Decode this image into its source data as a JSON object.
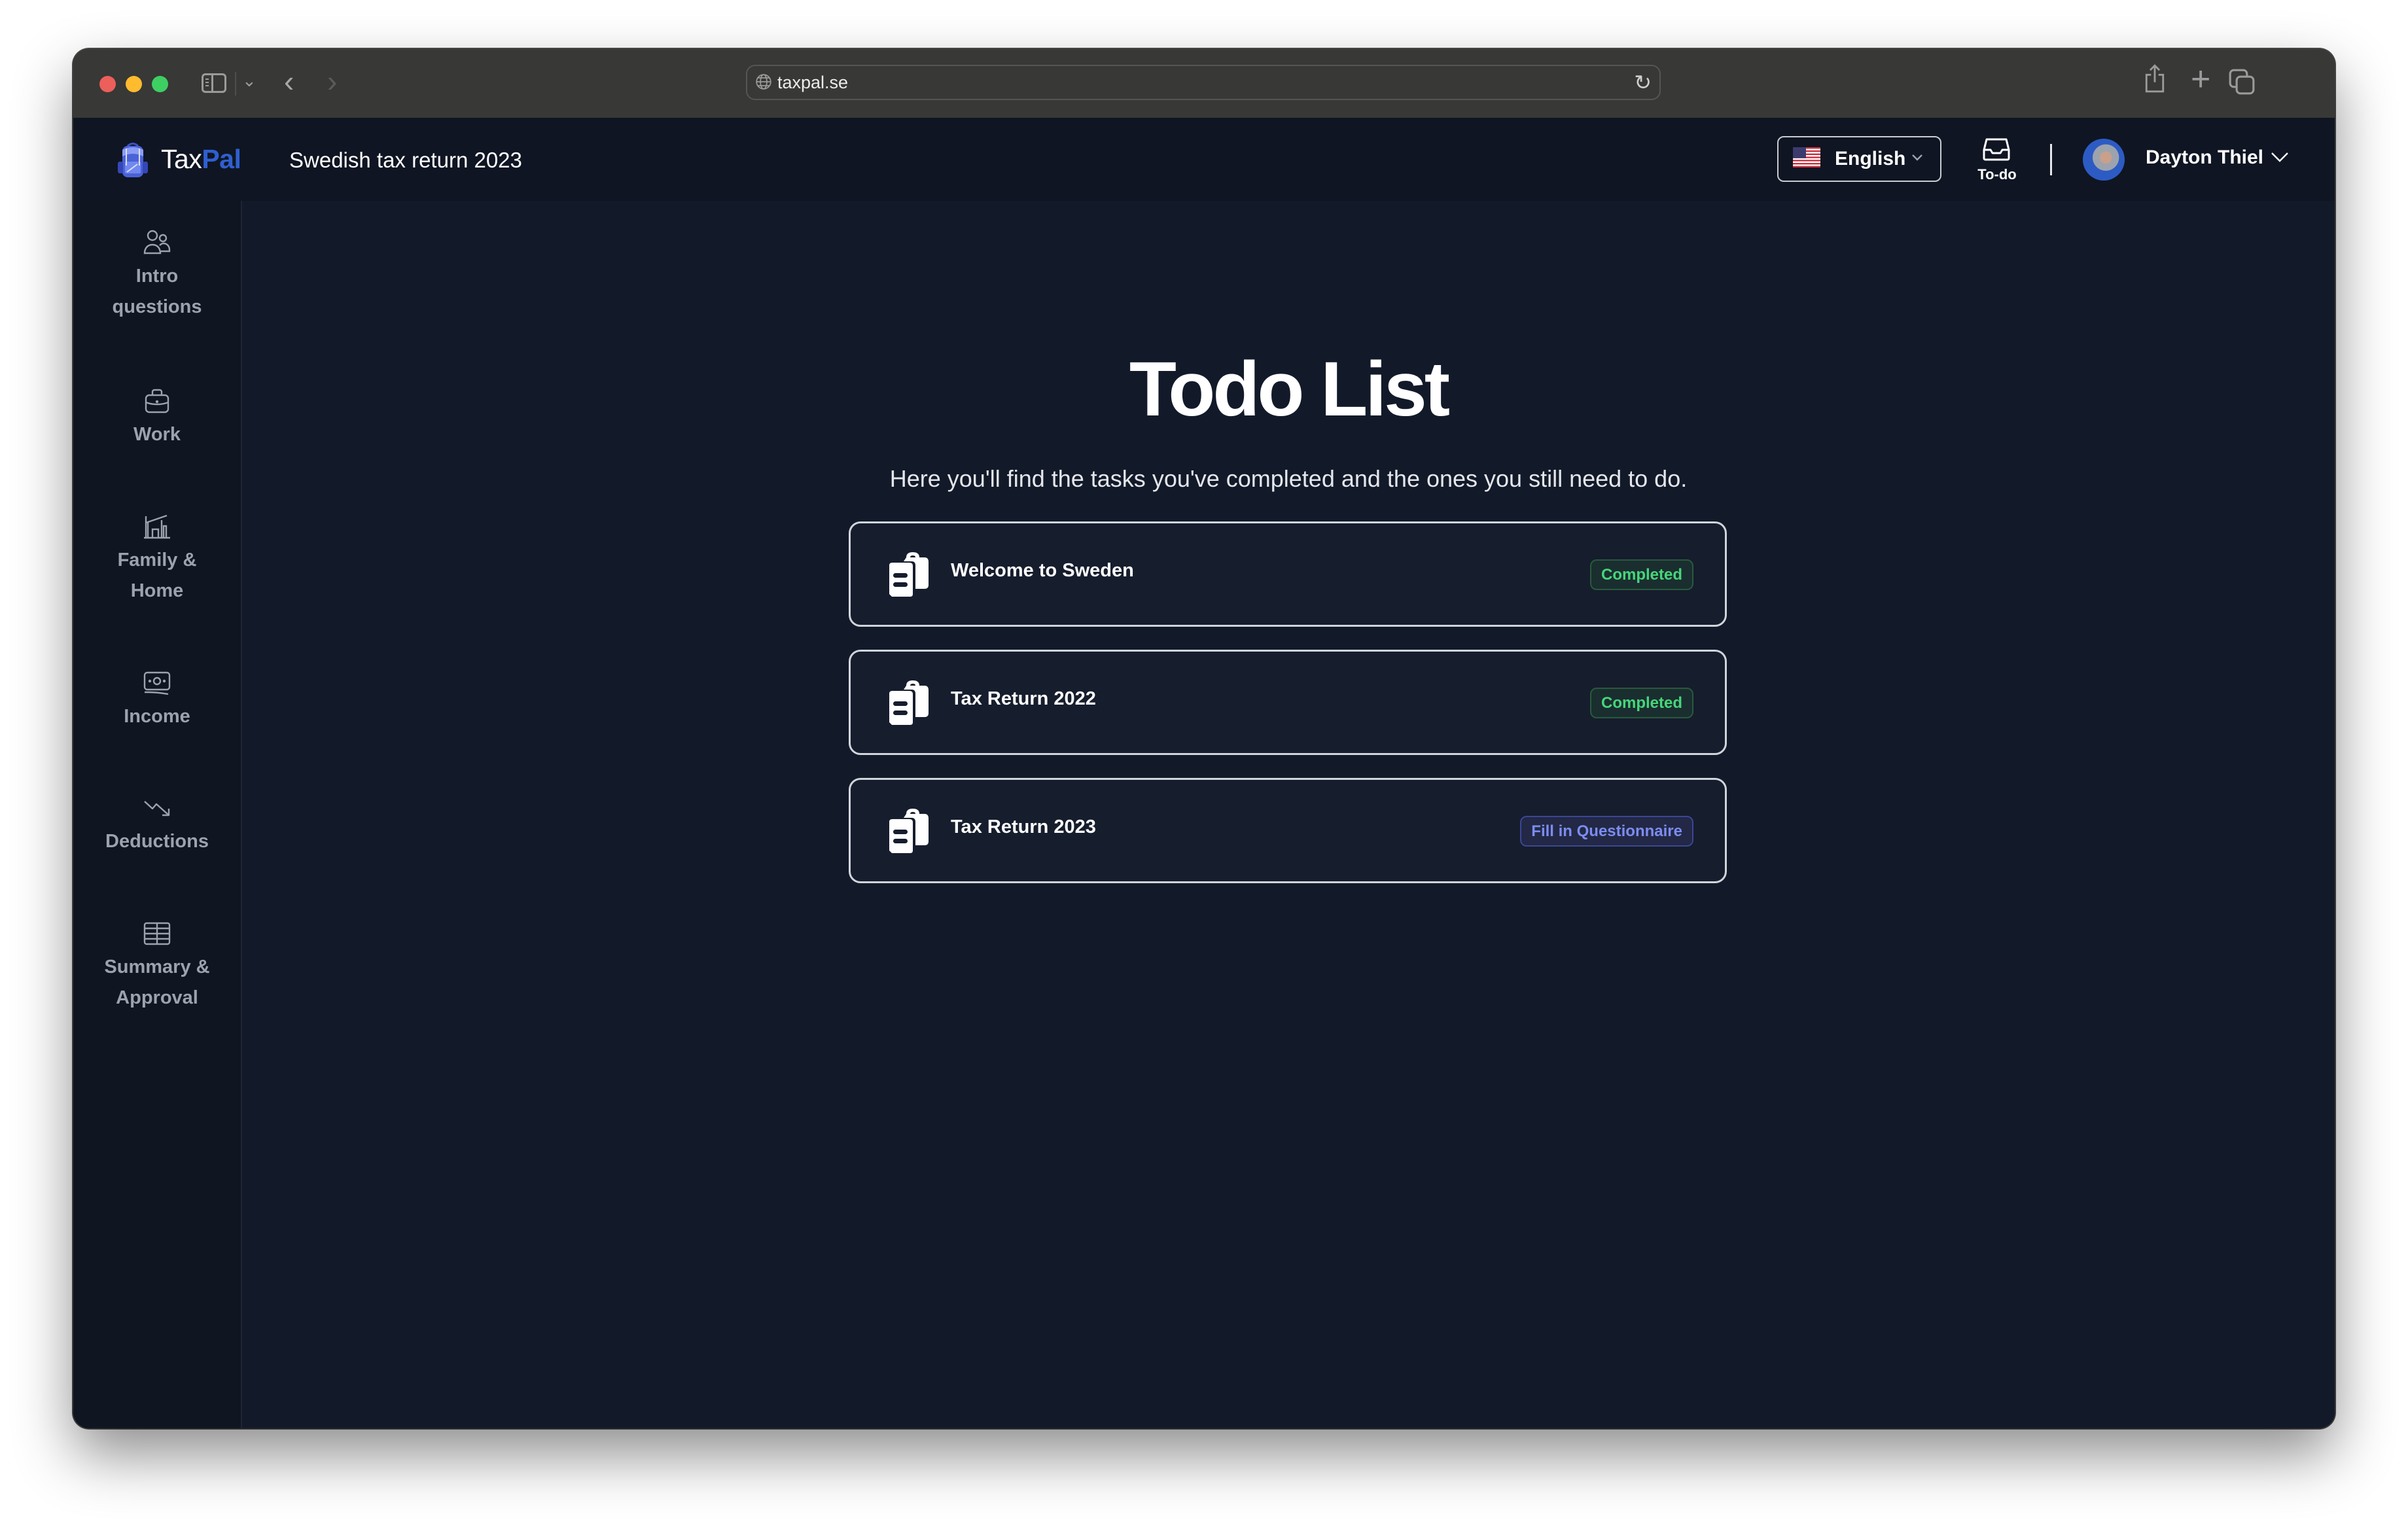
{
  "browser": {
    "url": "taxpal.se",
    "icons": {
      "sidebar_toggle": "sidebar-toggle-icon",
      "back": "chevron-left-icon",
      "forward": "chevron-right-icon",
      "globe": "globe-icon",
      "reload": "reload-icon",
      "share": "share-icon",
      "new_tab": "plus-icon",
      "tab_overview": "tabs-icon"
    },
    "glyphs": {
      "back": "‹",
      "forward": "›",
      "reload": "↻",
      "plus": "+",
      "dropdown": "⌄"
    }
  },
  "header": {
    "logo": {
      "text_primary": "Tax",
      "text_accent": "Pal",
      "accent_color": "#2f5fd0"
    },
    "app_title": "Swedish tax return 2023",
    "language": {
      "selected": "English",
      "flag": "us-flag-icon"
    },
    "todo": {
      "label": "To-do",
      "icon": "inbox-icon"
    },
    "user": {
      "name": "Dayton Thiel"
    }
  },
  "sidebar": {
    "items": [
      {
        "label_lines": [
          "Intro",
          "questions"
        ],
        "icon": "users-icon"
      },
      {
        "label_lines": [
          "Work"
        ],
        "icon": "briefcase-icon"
      },
      {
        "label_lines": [
          "Family &",
          "Home"
        ],
        "icon": "home-icon"
      },
      {
        "label_lines": [
          "Income"
        ],
        "icon": "banknotes-icon"
      },
      {
        "label_lines": [
          "Deductions"
        ],
        "icon": "trending-down-icon"
      },
      {
        "label_lines": [
          "Summary &",
          "Approval"
        ],
        "icon": "table-icon"
      }
    ]
  },
  "main": {
    "title": "Todo List",
    "subtitle": "Here you'll find the tasks you've completed and the ones you still need to do.",
    "tasks": [
      {
        "title": "Welcome to Sweden",
        "status": "Completed",
        "status_type": "completed",
        "icon": "clipboard-document-icon"
      },
      {
        "title": "Tax Return 2022",
        "status": "Completed",
        "status_type": "completed",
        "icon": "clipboard-document-icon"
      },
      {
        "title": "Tax Return 2023",
        "status": "Fill in Questionnaire",
        "status_type": "pending",
        "icon": "clipboard-document-icon"
      }
    ]
  },
  "colors": {
    "completed_text": "#46d679",
    "pending_text": "#7c8cf0",
    "page_bg": "#121a2a",
    "brand_blue": "#2f5fd0"
  }
}
